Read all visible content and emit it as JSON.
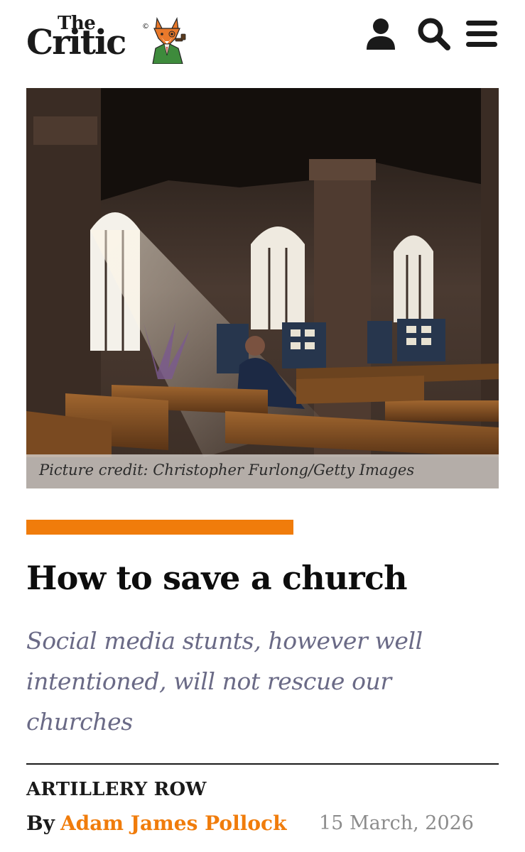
{
  "header": {
    "logo_the": "The",
    "logo_critic": "Critic",
    "logo_copyright": "©",
    "icons": [
      "user-icon",
      "search-icon",
      "menu-icon"
    ]
  },
  "hero": {
    "credit": "Picture credit: Christopher Furlong/Getty Images"
  },
  "article": {
    "title": "How to save a church",
    "standfirst": "Social media stunts, however well intentioned, will not rescue our churches",
    "section": "ARTILLERY ROW",
    "by_label": "By",
    "author": "Adam James Pollock",
    "date": "15 March, 2026"
  },
  "colors": {
    "accent": "#f07c0b",
    "standfirst": "#6a6a86",
    "date": "#8c8c8c",
    "text": "#1a1a1a"
  }
}
